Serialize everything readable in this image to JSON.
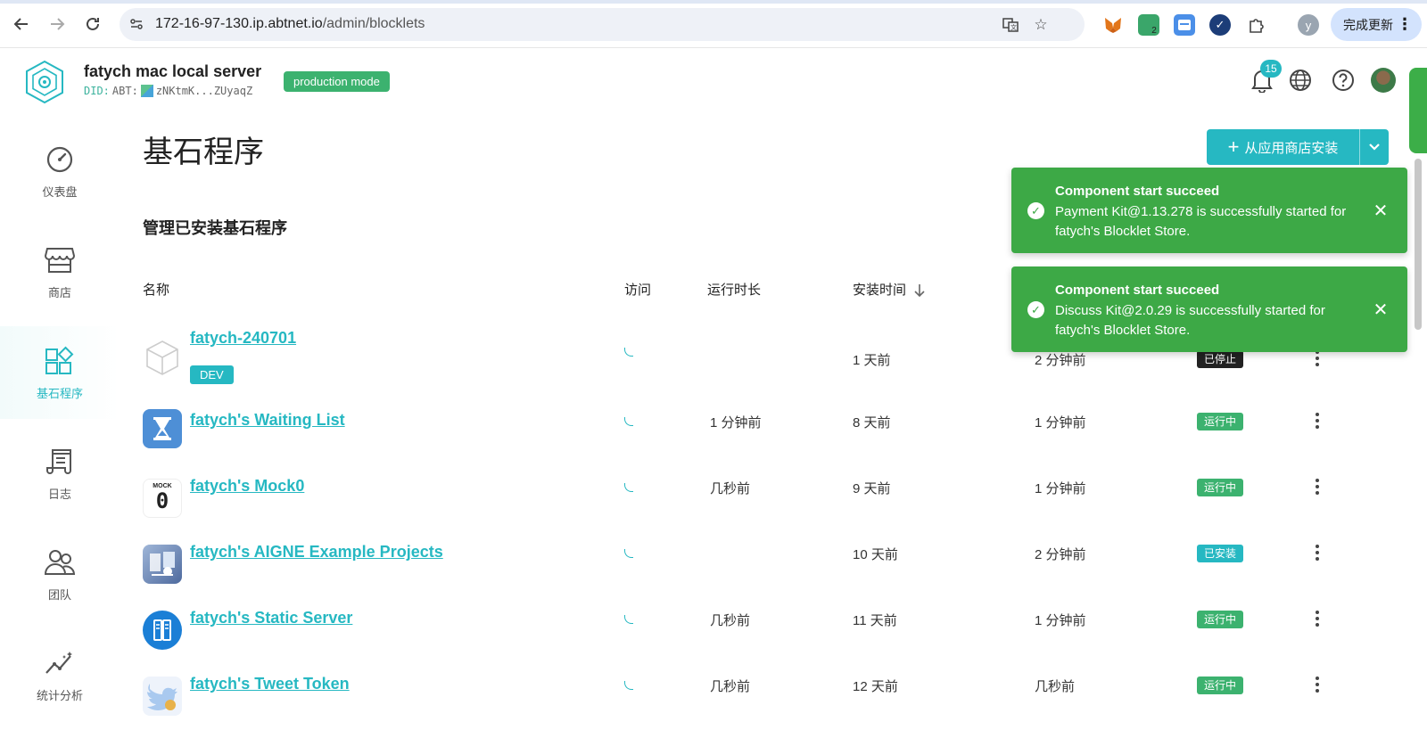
{
  "browser": {
    "url_host": "172-16-97-130.ip.abtnet.io",
    "url_path": "/admin/blocklets",
    "profile_initial": "y",
    "update_label": "完成更新",
    "extension_badge": "2"
  },
  "header": {
    "server_name": "fatych mac local server",
    "did_prefix": "DID:",
    "did_mid": "ABT:",
    "did_value": "zNKtmK...ZUyaqZ",
    "mode": "production mode",
    "notification_count": "15"
  },
  "sidebar": {
    "items": [
      {
        "label": "仪表盘",
        "icon": "dashboard-gauge-icon"
      },
      {
        "label": "商店",
        "icon": "store-icon"
      },
      {
        "label": "基石程序",
        "icon": "blocklets-icon"
      },
      {
        "label": "日志",
        "icon": "logs-icon"
      },
      {
        "label": "团队",
        "icon": "team-icon"
      },
      {
        "label": "统计分析",
        "icon": "analytics-icon"
      }
    ]
  },
  "main": {
    "title": "基石程序",
    "install_button": "从应用商店安装",
    "section_title": "管理已安装基石程序",
    "columns": {
      "name": "名称",
      "access": "访问",
      "uptime": "运行时长",
      "installed": "安装时间"
    },
    "rows": [
      {
        "name": "fatych-240701",
        "tag": "DEV",
        "uptime": "",
        "installed": "1 天前",
        "updated": "2 分钟前",
        "status": "已停止",
        "status_kind": "stopped"
      },
      {
        "name": "fatych's Waiting List",
        "uptime": "1 分钟前",
        "installed": "8 天前",
        "updated": "1 分钟前",
        "status": "运行中",
        "status_kind": "running"
      },
      {
        "name": "fatych's Mock0",
        "uptime": "几秒前",
        "installed": "9 天前",
        "updated": "1 分钟前",
        "status": "运行中",
        "status_kind": "running"
      },
      {
        "name": "fatych's AIGNE Example Projects",
        "uptime": "",
        "installed": "10 天前",
        "updated": "2 分钟前",
        "status": "已安装",
        "status_kind": "installed"
      },
      {
        "name": "fatych's Static Server",
        "uptime": "几秒前",
        "installed": "11 天前",
        "updated": "1 分钟前",
        "status": "运行中",
        "status_kind": "running"
      },
      {
        "name": "fatych's Tweet Token",
        "uptime": "几秒前",
        "installed": "12 天前",
        "updated": "几秒前",
        "status": "运行中",
        "status_kind": "running"
      }
    ],
    "mock_icon_text": "MOCK",
    "mock_icon_digit": "0"
  },
  "toasts": [
    {
      "title": "Component start succeed",
      "message": "Payment Kit@1.13.278 is successfully started for fatych's Blocklet Store."
    },
    {
      "title": "Component start succeed",
      "message": "Discuss Kit@2.0.29 is successfully started for fatych's Blocklet Store."
    }
  ],
  "colors": {
    "accent": "#26b8c2",
    "success": "#3cb26f",
    "toast": "#3da946"
  }
}
